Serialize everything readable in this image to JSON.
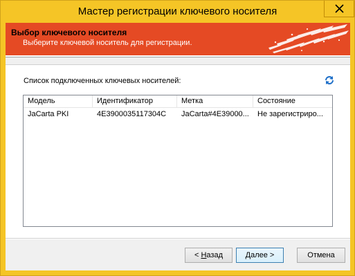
{
  "window": {
    "title": "Мастер регистрации ключевого носителя",
    "close_glyph": "✕"
  },
  "banner": {
    "title": "Выбор ключевого носителя",
    "subtitle": "Выберите ключевой носитель для регистрации."
  },
  "list": {
    "caption": "Список подключенных ключевых носителей:",
    "columns": [
      "Модель",
      "Идентификатор",
      "Метка",
      "Состояние"
    ],
    "rows": [
      [
        "JaCarta PKI",
        "4E3900035117304C",
        "JaCarta#4E39000...",
        "Не зарегистриро..."
      ]
    ]
  },
  "buttons": {
    "back_prefix": "< ",
    "back_mnemonic": "Н",
    "back_rest": "азад",
    "next_mnemonic": "Д",
    "next_rest": "алее >",
    "cancel": "Отмена"
  },
  "colors": {
    "titlebar": "#f5c526",
    "banner": "#e54a24",
    "accent_blue": "#1e6fc8"
  },
  "icons": {
    "close": "close-icon",
    "refresh": "refresh-icon"
  }
}
